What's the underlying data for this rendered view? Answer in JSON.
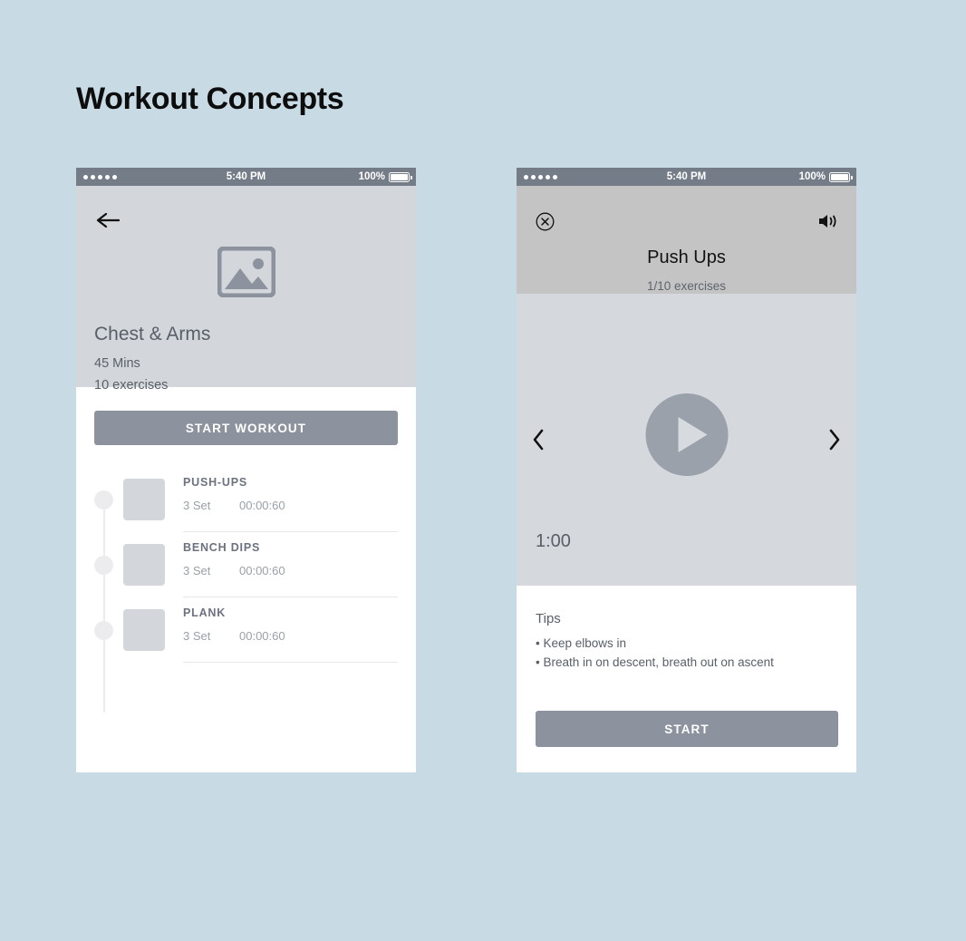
{
  "page": {
    "title": "Workout Concepts",
    "background_color": "#c8dbe4"
  },
  "status_bar": {
    "signal_dots": 5,
    "time": "5:40 PM",
    "battery_percent": "100%"
  },
  "phone1": {
    "back_icon": "arrow-left-icon",
    "placeholder_icon": "image-placeholder-icon",
    "workout_title": "Chest & Arms",
    "duration": "45 Mins",
    "exercise_count": "10 exercises",
    "start_workout_label": "START WORKOUT",
    "exercises": [
      {
        "name": "PUSH-UPS",
        "sets": "3 Set",
        "time": "00:00:60"
      },
      {
        "name": "BENCH DIPS",
        "sets": "3 Set",
        "time": "00:00:60"
      },
      {
        "name": "PLANK",
        "sets": "3 Set",
        "time": "00:00:60"
      }
    ]
  },
  "phone2": {
    "close_icon": "close-circle-icon",
    "sound_icon": "speaker-volume-icon",
    "exercise_title": "Push Ups",
    "progress": "1/10 exercises",
    "play_icon": "play-circle-icon",
    "prev_icon": "chevron-left-icon",
    "next_icon": "chevron-right-icon",
    "timer": "1:00",
    "tips_title": "Tips",
    "tips": [
      "• Keep elbows in",
      "• Breath in on descent, breath out on ascent"
    ],
    "start_label": "START"
  },
  "colors": {
    "accent_button": "#8c939e",
    "header_grey": "#c4c4c4",
    "hero_grey": "#d3d6da",
    "status_bar": "#747c87"
  }
}
